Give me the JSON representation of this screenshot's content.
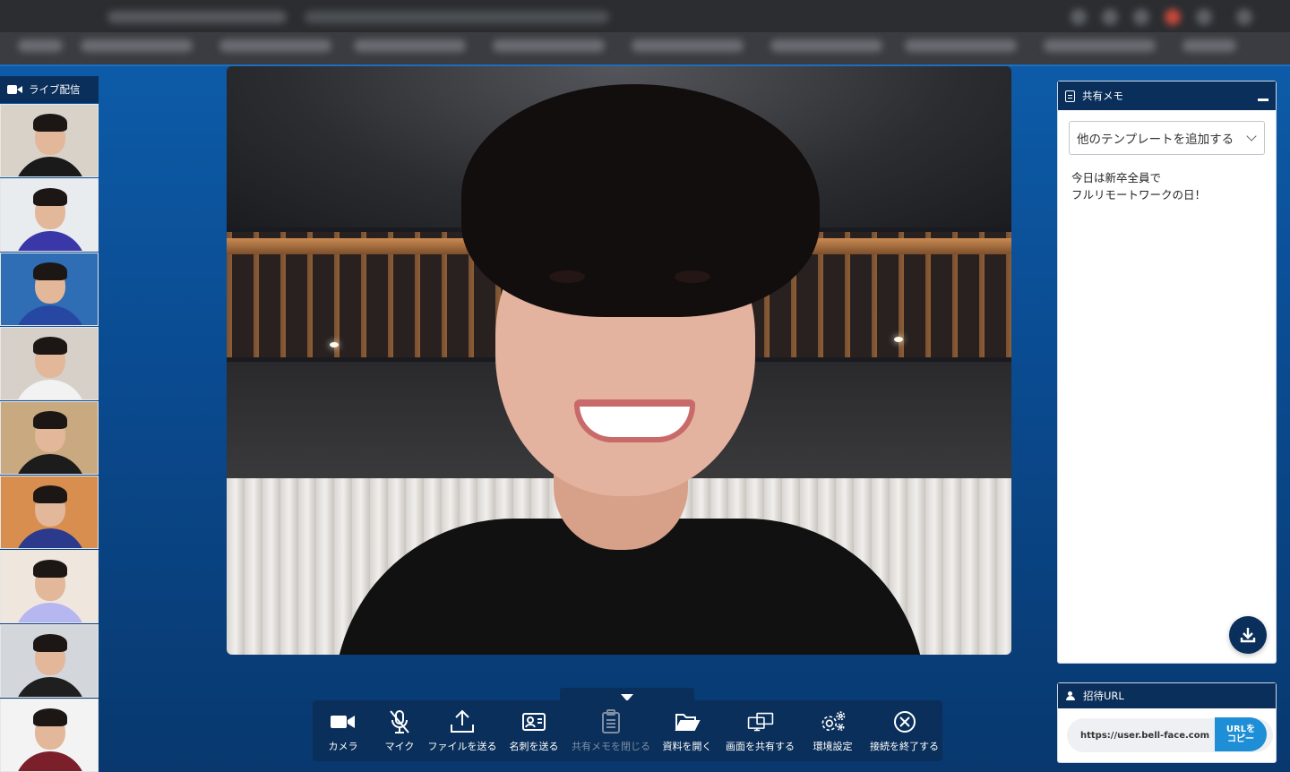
{
  "live": {
    "title": "ライブ配信"
  },
  "participants": [
    {
      "bg": "#d9d2c8",
      "shirt": "#1a1a1a"
    },
    {
      "bg": "#e9ecef",
      "shirt": "#3a37a8"
    },
    {
      "bg": "#2f6db5",
      "shirt": "#2648a3"
    },
    {
      "bg": "#d7d0c9",
      "shirt": "#f2f2f2"
    },
    {
      "bg": "#c9a97f",
      "shirt": "#1c1c1c"
    },
    {
      "bg": "#d88e4f",
      "shirt": "#2b3a8d"
    },
    {
      "bg": "#efe6de",
      "shirt": "#b6b6f0"
    },
    {
      "bg": "#d3d7dc",
      "shirt": "#1f1f1f"
    },
    {
      "bg": "#f3f3f3",
      "shirt": "#7b1f2b"
    }
  ],
  "memo": {
    "title": "共有メモ",
    "template_select": "他のテンプレートを追加する",
    "line1": "今日は新卒全員で",
    "line2": "フルリモートワークの日！"
  },
  "invite": {
    "title": "招待URL",
    "url": "https://user.bell-face.com",
    "copy_label": "URLを\nコピー"
  },
  "toolbar": {
    "camera": "カメラ",
    "mic": "マイク",
    "send_file": "ファイルを送る",
    "send_card": "名刺を送る",
    "close_memo": "共有メモを閉じる",
    "open_docs": "資料を開く",
    "share_screen": "画面を共有する",
    "settings": "環境設定",
    "end_call": "接続を終了する"
  }
}
